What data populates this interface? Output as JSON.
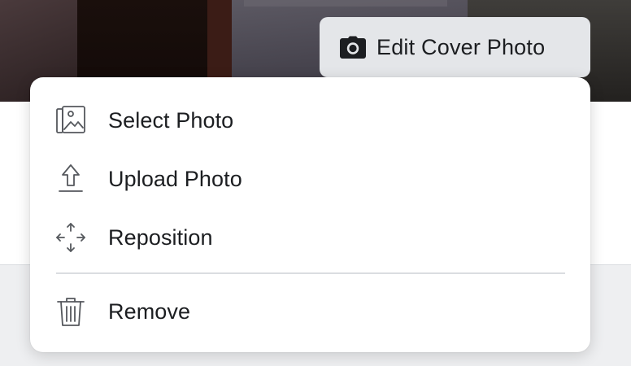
{
  "cover_photo": {
    "edit_button_label": "Edit Cover Photo",
    "edit_button_icon": "camera-icon"
  },
  "menu": {
    "items": [
      {
        "label": "Select Photo",
        "icon": "photo-album-icon"
      },
      {
        "label": "Upload Photo",
        "icon": "upload-icon"
      },
      {
        "label": "Reposition",
        "icon": "move-arrows-icon"
      },
      {
        "label": "Remove",
        "icon": "trash-icon"
      }
    ]
  },
  "colors": {
    "text": "#1c1e21",
    "button_bg": "#e4e6e9",
    "menu_bg": "#ffffff",
    "divider": "#dadde1"
  }
}
